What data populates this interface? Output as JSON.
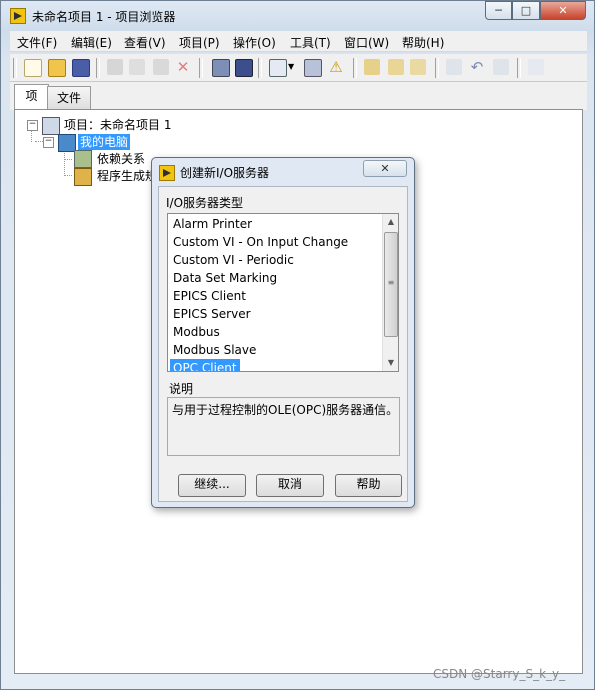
{
  "window": {
    "title": "未命名项目 1 - 项目浏览器",
    "minimize_glyph": "─",
    "maximize_glyph": "□",
    "close_glyph": "✕"
  },
  "menubar": [
    "文件(F)",
    "编辑(E)",
    "查看(V)",
    "项目(P)",
    "操作(O)",
    "工具(T)",
    "窗口(W)",
    "帮助(H)"
  ],
  "toolbar": {
    "icons": [
      "new-icon",
      "open-icon",
      "save-all-icon",
      "cut-icon",
      "copy-icon",
      "paste-icon",
      "delete-icon",
      "build-icon",
      "save-icon",
      "view-options-icon",
      "dropdown-icon",
      "replace-icon",
      "warning-icon",
      "dependencies-icon",
      "refresh-icon",
      "resolve-icon",
      "check-icon",
      "undo-icon",
      "redo-icon",
      "add-icon"
    ]
  },
  "tabs": {
    "items": "项",
    "files": "文件"
  },
  "tree": {
    "project": "项目：未命名项目 1",
    "computer": "我的电脑",
    "dependencies": "依赖关系",
    "build_specs": "程序生成规范"
  },
  "dialog": {
    "title": "创建新I/O服务器",
    "close_glyph": "✕",
    "type_label": "I/O服务器类型",
    "server_types": [
      "Alarm Printer",
      "Custom VI - On Input Change",
      "Custom VI - Periodic",
      "Data Set Marking",
      "EPICS Client",
      "EPICS Server",
      "Modbus",
      "Modbus Slave",
      "OPC Client"
    ],
    "selected": "OPC Client",
    "description_label": "说明",
    "description": "与用于过程控制的OLE(OPC)服务器通信。",
    "buttons": {
      "continue": "继续...",
      "cancel": "取消",
      "help": "帮助"
    },
    "scroll": {
      "up": "▲",
      "down": "▼",
      "grip": "≡"
    }
  },
  "tree_expanders": {
    "project": "−",
    "computer": "−"
  },
  "watermark": "CSDN @Starry_S_k_y_",
  "colors": {
    "selection": "#3399ff",
    "accent": "#f3c312"
  }
}
